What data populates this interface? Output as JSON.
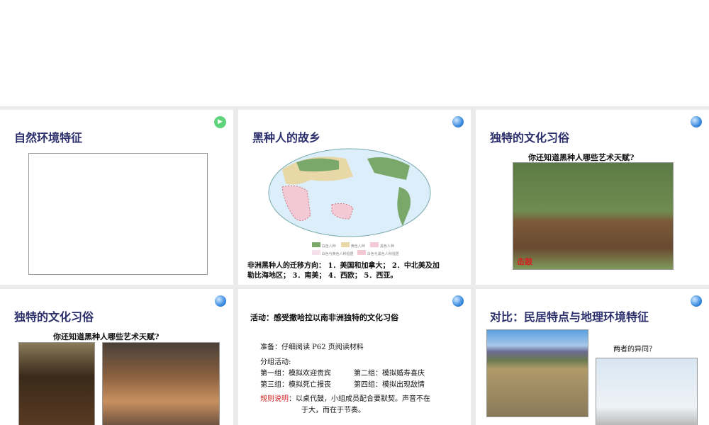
{
  "slides": [
    {
      "title": "自然环境特征",
      "icon": "video-icon"
    },
    {
      "title": "黑种人的故乡",
      "legend": [
        "白色人种",
        "黄色人种",
        "黑色人种",
        "白色与黄色人种混居",
        "白色与黑色人种混居"
      ],
      "text1": "非洲黑种人的迁移方向： 1．美国和加拿大；  2．中北美及加",
      "text2": "勒比海地区； 3．南美；  4．西欧； 5．西亚。"
    },
    {
      "title": "独特的文化习俗",
      "question": "你还知道黑种人哪些艺术天赋?",
      "caption": "击鼓"
    },
    {
      "title": "独特的文化习俗",
      "question": "你还知道黑种人哪些艺术天赋?"
    },
    {
      "heading": "活动：感受撒哈拉以南非洲独特的文化习俗",
      "prep": "准备：仔细阅读 P62 页阅读材料",
      "group_label": "分组活动:",
      "g1": "第一组：模拟欢迎贵宾",
      "g2": "第二组：模拟婚寿喜庆",
      "g3": "第三组：模拟死亡报丧",
      "g4": "第四组：模拟出现敌情",
      "rule_label": "规则说明",
      "rule1": "：以桌代鼓，小组成员配合要默契。声音不在",
      "rule2": "于大，而在于节奏。"
    },
    {
      "title": "对比：民居特点与地理环境特征",
      "question": "两者的异同？"
    }
  ],
  "colors": {
    "title": "#2b2f6b",
    "accent_red": "#d42020"
  }
}
